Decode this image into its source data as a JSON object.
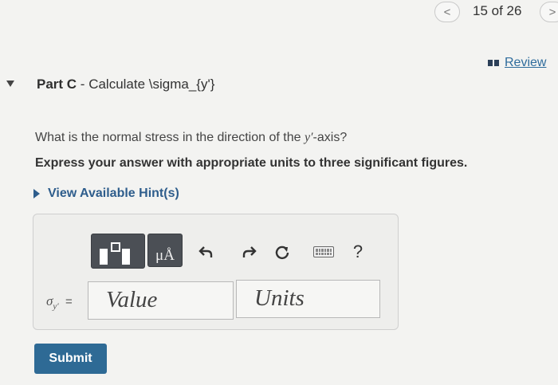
{
  "navigation": {
    "prev_icon": "<",
    "position_text": "15 of 26",
    "next_icon": ">"
  },
  "review": {
    "label": "Review",
    "icon": "book-icon"
  },
  "part": {
    "toggle_icon": "caret-down-icon",
    "prefix": "Part C",
    "separator": " - ",
    "title": "Calculate \\sigma_{y'}"
  },
  "question": {
    "text_before": "What is the normal stress in the direction of the ",
    "variable": "y′",
    "text_after": "-axis?"
  },
  "instruction": "Express your answer with appropriate units to three significant figures.",
  "hints": {
    "label": "View Available Hint(s)"
  },
  "toolbar": {
    "template_icon": "templates-icon",
    "units_icon_text": "μÅ",
    "undo_icon": "undo-icon",
    "redo_icon": "redo-icon",
    "reset_icon": "reset-icon",
    "keyboard_icon": "keyboard-icon",
    "help_label": "?"
  },
  "answer": {
    "variable_label": "σ",
    "variable_subscript": "y′",
    "equals": "=",
    "value_placeholder": "Value",
    "units_placeholder": "Units"
  },
  "submit": {
    "label": "Submit"
  },
  "colors": {
    "link": "#2f6c9c",
    "submit_bg": "#2e6a95",
    "toolbar_dark": "#4b4f55"
  }
}
